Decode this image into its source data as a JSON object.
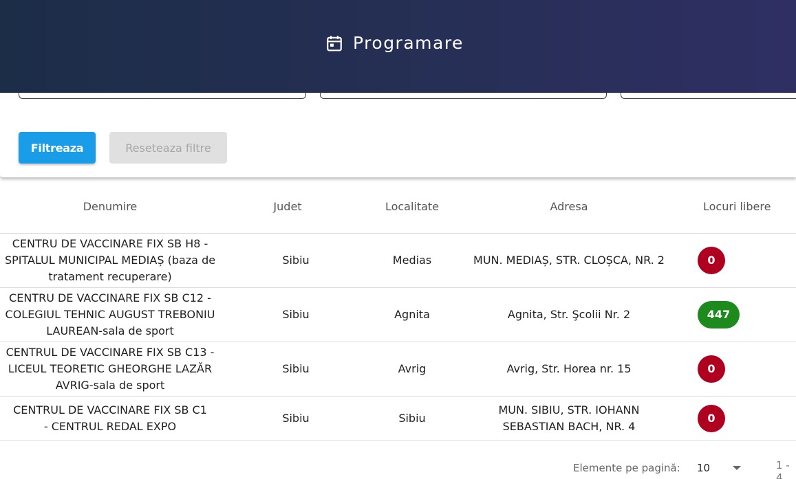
{
  "header": {
    "title": "Programare",
    "icon": "calendar-icon"
  },
  "filters": {
    "filter_button": "Filtreaza",
    "reset_button": "Reseteaza filtre"
  },
  "table": {
    "columns": [
      "Denumire",
      "Judet",
      "Localitate",
      "Adresa",
      "Locuri libere"
    ],
    "rows": [
      {
        "name": "CENTRU DE VACCINARE FIX SB H8 - SPITALUL MUNICIPAL MEDIAȘ (baza de tratament recuperare)",
        "county": "Sibiu",
        "locality": "Medias",
        "address": "MUN. MEDIAȘ, STR. CLOȘCA, NR. 2",
        "free": "0",
        "status_color": "#b00020"
      },
      {
        "name": "CENTRU DE VACCINARE FIX SB C12 - COLEGIUL TEHNIC AUGUST TREBONIU LAUREAN-sala de sport",
        "county": "Sibiu",
        "locality": "Agnita",
        "address": "Agnita, Str. Şcolii Nr. 2",
        "free": "447",
        "status_color": "#1c8a1c"
      },
      {
        "name": "CENTRUL DE VACCINARE FIX SB C13 - LICEUL TEORETIC GHEORGHE LAZĂR AVRIG-sala de sport",
        "county": "Sibiu",
        "locality": "Avrig",
        "address": "Avrig, Str. Horea nr. 15",
        "free": "0",
        "status_color": "#b00020"
      },
      {
        "name": "CENTRUL DE VACCINARE FIX SB C1 - CENTRUL REDAL EXPO",
        "county": "Sibiu",
        "locality": "Sibiu",
        "address": "MUN. SIBIU, STR. IOHANN SEBASTIAN BACH, NR. 4",
        "free": "0",
        "status_color": "#b00020"
      }
    ]
  },
  "paginator": {
    "items_per_page_label": "Elemente pe pagină:",
    "items_per_page_value": "10",
    "range_label": "1 - 4"
  },
  "colors": {
    "header_start": "#1c2d48",
    "header_end": "#2f2f63",
    "primary": "#1a9de8",
    "badge_red": "#b00020",
    "badge_green": "#1c8a1c"
  }
}
